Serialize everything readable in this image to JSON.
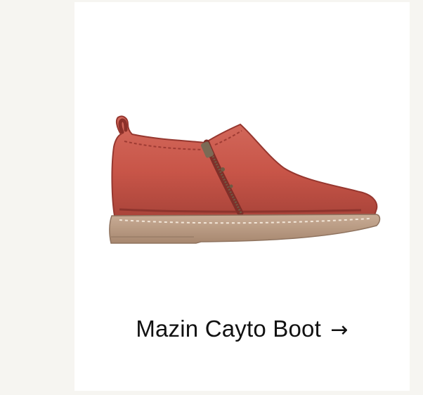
{
  "product": {
    "name": "Mazin Cayto Boot",
    "arrow_icon": "right-arrow-icon",
    "arrow_glyph": "→"
  },
  "colors": {
    "background": "#f6f5f1",
    "card": "#ffffff",
    "boot_leather": "#c9584b",
    "boot_sole": "#b89a82",
    "text": "#111111"
  }
}
